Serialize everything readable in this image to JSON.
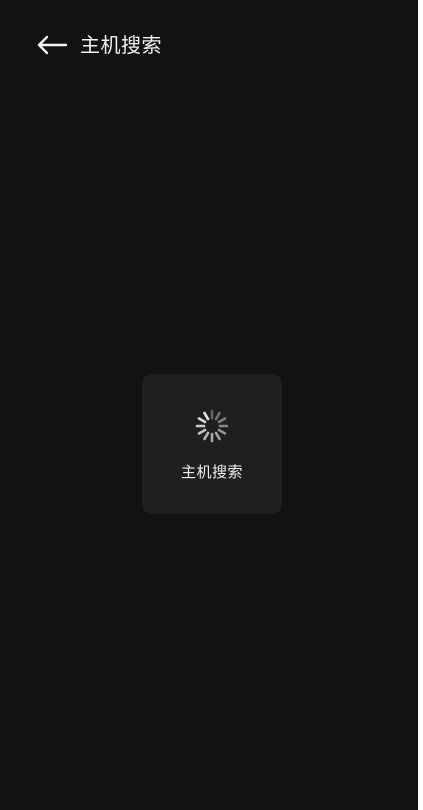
{
  "header": {
    "back_icon": "arrow-left-icon",
    "title": "主机搜索"
  },
  "loading": {
    "icon": "spinner-icon",
    "label": "主机搜索"
  },
  "colors": {
    "background": "#121212",
    "toast_background": "#1f1f1f",
    "text": "#f2f2f2"
  }
}
